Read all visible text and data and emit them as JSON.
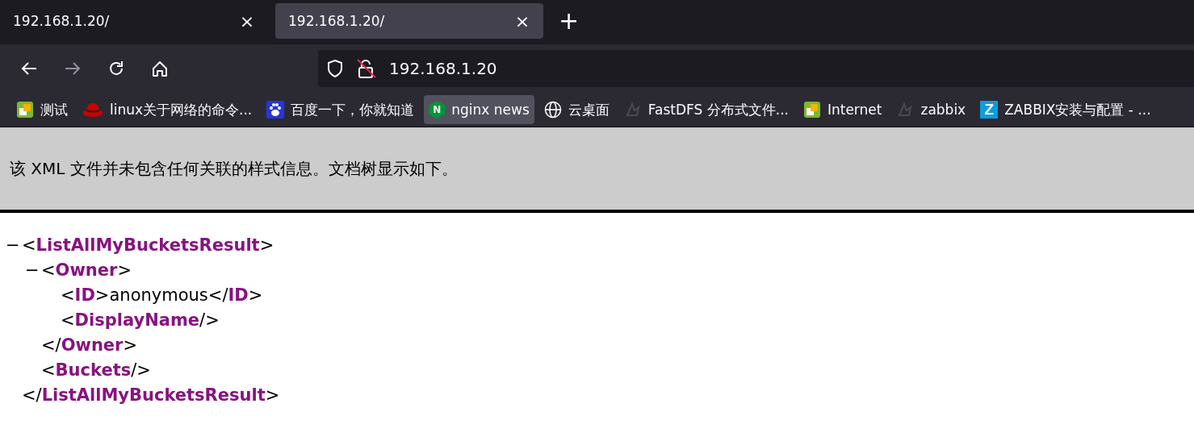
{
  "tabs": [
    {
      "title": "192.168.1.20/",
      "close": "×",
      "selected": false
    },
    {
      "title": "192.168.1.20/",
      "close": "×",
      "selected": true
    }
  ],
  "new_tab": "+",
  "toolbar": {
    "back": {
      "disabled": false
    },
    "forward": {
      "disabled": true
    },
    "address": "192.168.1.20"
  },
  "bookmarks": [
    {
      "kind": "squares",
      "label": "测试",
      "highlighted": false
    },
    {
      "kind": "hat",
      "label": "linux关于网络的命令...",
      "highlighted": false
    },
    {
      "kind": "paw",
      "label": "百度一下，你就知道",
      "highlighted": false
    },
    {
      "kind": "hexagon",
      "glyph": "N",
      "label": "nginx news",
      "highlighted": true
    },
    {
      "kind": "globe",
      "label": "云桌面",
      "highlighted": false
    },
    {
      "kind": "faded",
      "label": "FastDFS 分布式文件...",
      "highlighted": false
    },
    {
      "kind": "squares",
      "label": "Internet",
      "highlighted": false
    },
    {
      "kind": "faded",
      "label": "zabbix",
      "highlighted": false
    },
    {
      "kind": "tile",
      "glyph": "Z",
      "label": "ZABBIX安装与配置 - ...",
      "highlighted": false
    }
  ],
  "info": "该 XML 文件并未包含任何关联的样式信息。文档树显示如下。",
  "tree": [
    {
      "toggle": "−",
      "expanded": true,
      "open": [
        {
          "kind": "mark",
          "text": "<"
        },
        {
          "kind": "tag",
          "text": "ListAllMyBucketsResult"
        },
        {
          "kind": "mark",
          "text": ">"
        }
      ],
      "children": [
        {
          "toggle": "−",
          "expanded": true,
          "open": [
            {
              "kind": "mark",
              "text": "<"
            },
            {
              "kind": "tag",
              "text": "Owner"
            },
            {
              "kind": "mark",
              "text": ">"
            }
          ],
          "children": [
            {
              "open": [
                {
                  "kind": "mark",
                  "text": "<"
                },
                {
                  "kind": "tag",
                  "text": "ID"
                },
                {
                  "kind": "mark",
                  "text": ">"
                },
                {
                  "kind": "text",
                  "text": "anonymous"
                },
                {
                  "kind": "mark",
                  "text": "</"
                },
                {
                  "kind": "tag",
                  "text": "ID"
                },
                {
                  "kind": "mark",
                  "text": ">"
                }
              ]
            },
            {
              "open": [
                {
                  "kind": "mark",
                  "text": "<"
                },
                {
                  "kind": "tag",
                  "text": "DisplayName"
                },
                {
                  "kind": "mark",
                  "text": "/>"
                }
              ]
            }
          ],
          "close": [
            {
              "kind": "mark",
              "text": "</"
            },
            {
              "kind": "tag",
              "text": "Owner"
            },
            {
              "kind": "mark",
              "text": ">"
            }
          ]
        },
        {
          "open": [
            {
              "kind": "mark",
              "text": "<"
            },
            {
              "kind": "tag",
              "text": "Buckets"
            },
            {
              "kind": "mark",
              "text": "/>"
            }
          ]
        }
      ],
      "close": [
        {
          "kind": "mark",
          "text": "</"
        },
        {
          "kind": "tag",
          "text": "ListAllMyBucketsResult"
        },
        {
          "kind": "mark",
          "text": ">"
        }
      ]
    }
  ]
}
